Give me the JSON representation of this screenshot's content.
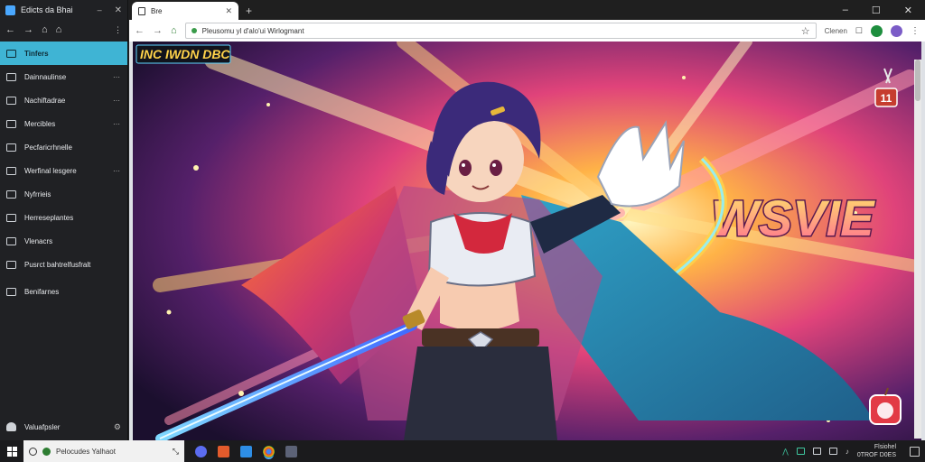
{
  "sidebar": {
    "title": "Edicts da Bhai",
    "items": [
      {
        "label": "Tinfers",
        "active": true,
        "more": ""
      },
      {
        "label": "Dainnaulinse",
        "more": "⋯"
      },
      {
        "label": "Nachiftadrae",
        "more": "⋯"
      },
      {
        "label": "Mercibles",
        "more": "⋯"
      },
      {
        "label": "Pecfaricrhnelle",
        "more": ""
      },
      {
        "label": "Werfinal lesgere",
        "more": "⋯"
      },
      {
        "label": "Nyfrrieis",
        "more": ""
      },
      {
        "label": "Herreseplantes",
        "more": ""
      },
      {
        "label": "Vlenacrs",
        "more": ""
      },
      {
        "label": "Pusrct bahtrelfusfralt",
        "more": ""
      },
      {
        "label": "Benifarnes",
        "more": ""
      }
    ],
    "footer_label": "Valuafpsler"
  },
  "browser": {
    "tab_title": "Bre",
    "url": "Pleusomu yl d'alo'ui Wirlogmant",
    "toolbar_text": "Clenen",
    "accent_green": "#1e8e3e",
    "accent_purple": "#7b5cc7"
  },
  "page": {
    "banner_text": "INC IWDN DBC",
    "hero_text": "WSVIE",
    "badge_number": "11"
  },
  "taskbar": {
    "search_placeholder": "Pelocudes Yalhaot",
    "clock_top": "Flsiohel",
    "clock_bottom": "0TROF D0ES"
  }
}
